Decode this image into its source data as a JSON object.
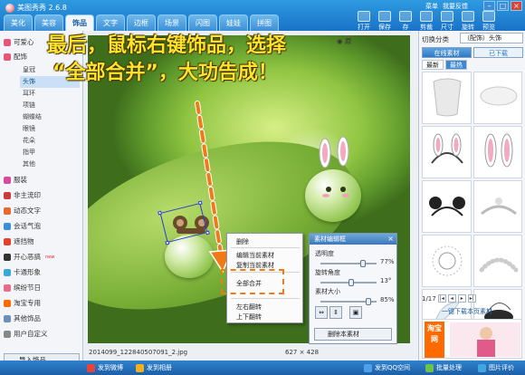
{
  "app": {
    "title": "美图秀秀 2.6.8"
  },
  "window_links": [
    "菜单",
    "我要反馈"
  ],
  "tabs": [
    "美化",
    "美容",
    "饰品",
    "文字",
    "边框",
    "场景",
    "闪图",
    "娃娃",
    "拼图"
  ],
  "toolbar": [
    "打开",
    "保存",
    "存",
    "剪裁",
    "尺寸",
    "旋转",
    "预览"
  ],
  "overlay": {
    "line1": "最后，鼠标右键饰品，选择",
    "line2": "“全部合并”，大功告成！"
  },
  "sidebar": {
    "items": [
      {
        "label": "可爱心",
        "color": "#e8557a"
      },
      {
        "label": "配饰",
        "color": "#e8557a"
      },
      {
        "label": "服装",
        "color": "#d84a9d"
      },
      {
        "label": "非主流印",
        "color": "#cc3a3a"
      },
      {
        "label": "动态文字",
        "color": "#e36b2d"
      },
      {
        "label": "会话气泡",
        "color": "#3b8fd8"
      },
      {
        "label": "遮挡物",
        "color": "#e3412d"
      },
      {
        "label": "开心恶搞",
        "color": "#333333",
        "badge": "new"
      },
      {
        "label": "卡通形象",
        "color": "#3aa8d8"
      },
      {
        "label": "缤纷节日",
        "color": "#e86b8b"
      },
      {
        "label": "淘宝专用",
        "color": "#ff6a00"
      },
      {
        "label": "其他饰品",
        "color": "#6b8fb8"
      },
      {
        "label": "用户自定义",
        "color": "#888888"
      }
    ],
    "subitems": [
      "皇冠",
      "头饰",
      "耳环",
      "项链",
      "蝴蝶结",
      "眼镜",
      "花朵",
      "指甲",
      "其他"
    ],
    "import_label": "导入饰品"
  },
  "canvas": {
    "compare_label": "原",
    "file_name": "2014099_122840507091_2.jpg",
    "image_size": "627 × 428"
  },
  "context_menu": {
    "items": [
      "删除",
      "编辑当前素材",
      "复制当前素材",
      "全部合并",
      "左右翻转",
      "上下翻转"
    ]
  },
  "material_panel": {
    "title": "素材编辑框",
    "rows": [
      {
        "label": "透明度",
        "value": "77%",
        "level": 0.77
      },
      {
        "label": "旋转角度",
        "value": "13°",
        "level": 0.55
      },
      {
        "label": "素材大小",
        "value": "85%",
        "level": 0.85
      }
    ],
    "delete_label": "删除本素材"
  },
  "right_panel": {
    "category_label": "切换分类",
    "category_value": "（配饰）头饰",
    "tab_online": "在线素材",
    "tab_downloaded": "已下载",
    "subtabs": [
      "最新",
      "最热"
    ],
    "page_text": "1/17",
    "apply_label": "一键下载本页素材",
    "ad_text": "淘宝网"
  },
  "statusbar": [
    {
      "label": "发到微博",
      "color": "#e8433a"
    },
    {
      "label": "发到相册",
      "color": "#f2b01e"
    },
    {
      "label": "发到QQ空间",
      "color": "#4ea1e8"
    },
    {
      "label": "批量处理",
      "color": "#6cc24a"
    },
    {
      "label": "图片评价",
      "color": "#3fa6e0"
    }
  ]
}
